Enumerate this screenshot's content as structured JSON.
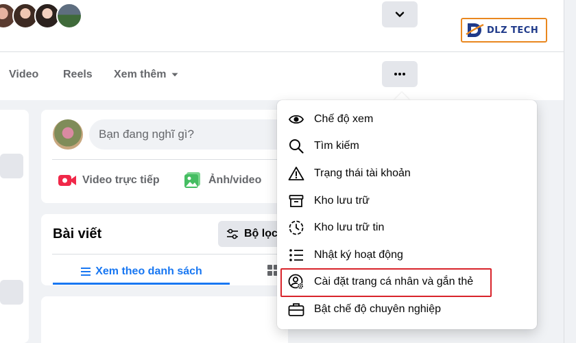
{
  "header": {
    "avatars": [
      "avatar-1",
      "avatar-2",
      "avatar-3",
      "avatar-4"
    ],
    "chevron_icon": "chevron-down-icon",
    "more_icon": "more-dots-icon"
  },
  "tabs": [
    {
      "label": "Video"
    },
    {
      "label": "Reels"
    },
    {
      "label": "Xem thêm"
    }
  ],
  "logo": {
    "text": "DLZ TECH",
    "brand_color": "#1f3a8a",
    "border_color": "#e9871e"
  },
  "composer": {
    "placeholder": "Bạn đang nghĩ gì?",
    "actions": [
      {
        "label": "Video trực tiếp",
        "icon": "live-video-icon",
        "color": "#f02849"
      },
      {
        "label": "Ảnh/video",
        "icon": "photo-icon",
        "color": "#45bd62"
      }
    ]
  },
  "posts": {
    "title": "Bài viết",
    "filter_label": "Bộ lọc",
    "list_view_label": "Xem theo danh sách"
  },
  "menu": {
    "items": [
      {
        "label": "Chế độ xem",
        "icon": "eye-icon"
      },
      {
        "label": "Tìm kiếm",
        "icon": "search-icon"
      },
      {
        "label": "Trạng thái tài khoản",
        "icon": "warning-icon"
      },
      {
        "label": "Kho lưu trữ",
        "icon": "archive-icon"
      },
      {
        "label": "Kho lưu trữ tin",
        "icon": "story-archive-icon"
      },
      {
        "label": "Nhật ký hoạt động",
        "icon": "activity-log-icon"
      },
      {
        "label": "Cài đặt trang cá nhân và gắn thẻ",
        "icon": "profile-settings-icon",
        "highlighted": true
      },
      {
        "label": "Bật chế độ chuyên nghiệp",
        "icon": "briefcase-icon"
      }
    ],
    "highlight_color": "#d8232a"
  },
  "colors": {
    "accent": "#1877f2",
    "secondary_text": "#65676b",
    "background": "#f0f2f5"
  }
}
